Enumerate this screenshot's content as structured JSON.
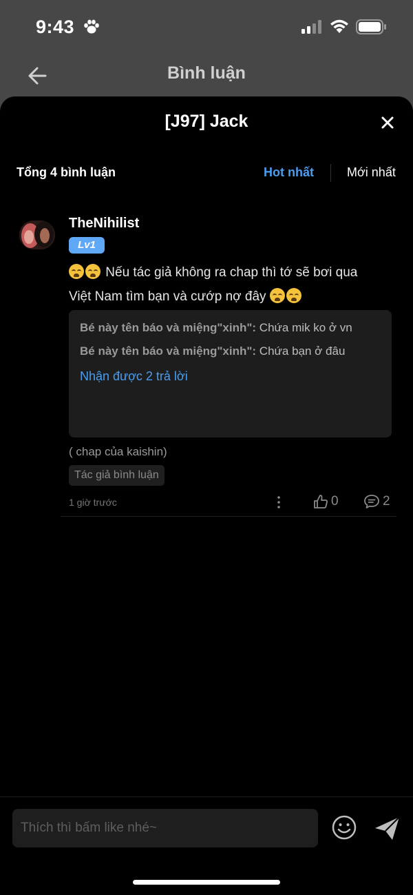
{
  "status_bar": {
    "time": "9:43"
  },
  "nav": {
    "title": "Bình luận"
  },
  "sheet": {
    "title": "[J97] Jack",
    "total_label": "Tổng 4 bình luận",
    "sort_hot": "Hot nhất",
    "sort_new": "Mới nhất"
  },
  "comment": {
    "username": "TheNihilist",
    "level": "Lv1",
    "text_line1": "Nếu tác giả không ra chap thì tớ sẽ bơi qua",
    "text_line2": "Việt Nam tìm bạn và cướp nợ đây",
    "replies": [
      {
        "author": "Bé này tên báo và miệng\"xinh\":",
        "text": " Chứa mik ko ở vn"
      },
      {
        "author": "Bé này tên báo và miệng\"xinh\":",
        "text": " Chứa bạn ở đâu"
      }
    ],
    "replies_more": "Nhận được 2 trả lời",
    "chap_note": "( chap của kaishin)",
    "author_tag": "Tác giả bình luận",
    "timestamp": "1 giờ trước",
    "likes": "0",
    "reply_count": "2"
  },
  "composer": {
    "placeholder": "Thích thì bấm like nhé~"
  },
  "colors": {
    "accent": "#4a9ef0",
    "level_badge": "#5ea8f5",
    "background": "#000000"
  },
  "icons": [
    "paw-icon",
    "signal-icon",
    "wifi-icon",
    "battery-icon",
    "back-arrow-icon",
    "close-icon",
    "more-vertical-icon",
    "thumbs-up-icon",
    "comment-icon",
    "smiley-icon",
    "send-icon"
  ]
}
